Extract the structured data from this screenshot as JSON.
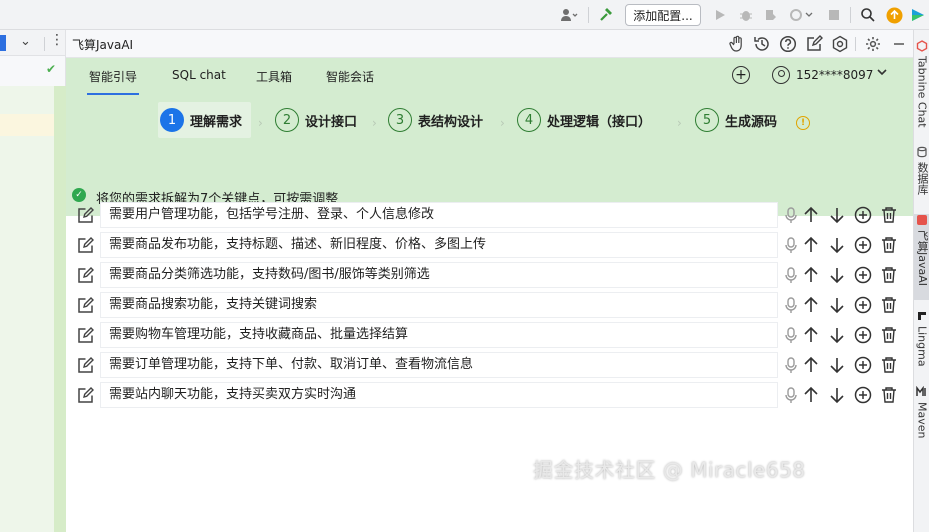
{
  "ide": {
    "toolbar": {
      "run_config_label": "添加配置..."
    }
  },
  "panel": {
    "title": "飞算JavaAI",
    "tabs": [
      {
        "label": "智能引导"
      },
      {
        "label": "SQL chat"
      },
      {
        "label": "工具箱"
      },
      {
        "label": "智能会话"
      }
    ],
    "user": {
      "name": "152****8097"
    },
    "steps": [
      {
        "num": "1",
        "label": "理解需求"
      },
      {
        "num": "2",
        "label": "设计接口"
      },
      {
        "num": "3",
        "label": "表结构设计"
      },
      {
        "num": "4",
        "label": "处理逻辑（接口）"
      },
      {
        "num": "5",
        "label": "生成源码"
      }
    ],
    "notice": "将您的需求拆解为7个关键点，可按需调整",
    "requirements": [
      "需要用户管理功能，包括学号注册、登录、个人信息修改",
      "需要商品发布功能，支持标题、描述、新旧程度、价格、多图上传",
      "需要商品分类筛选功能，支持数码/图书/服饰等类别筛选",
      "需要商品搜索功能，支持关键词搜索",
      "需要购物车管理功能，支持收藏商品、批量选择结算",
      "需要订单管理功能，支持下单、付款、取消订单、查看物流信息",
      "需要站内聊天功能，支持买卖双方实时沟通"
    ]
  },
  "right_tools": [
    {
      "label": "Tabnine Chat"
    },
    {
      "label": "数据库"
    },
    {
      "label": "飞算JavaAI"
    },
    {
      "label": "Lingma"
    },
    {
      "label": "Maven"
    }
  ],
  "watermark": "掘金技术社区 @ Miracle658",
  "colors": {
    "accent": "#1b74e8",
    "green_bg": "#d4ecd0",
    "step_border": "#2e7d32",
    "success": "#2fa84f",
    "warning": "#e0a400"
  }
}
